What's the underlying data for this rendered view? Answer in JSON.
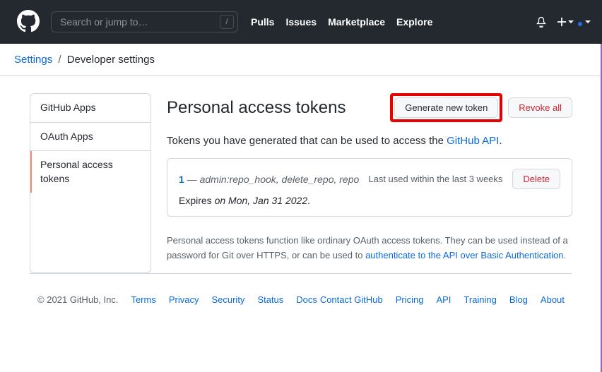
{
  "header": {
    "search_placeholder": "Search or jump to…",
    "slash": "/",
    "nav": {
      "pulls": "Pulls",
      "issues": "Issues",
      "marketplace": "Marketplace",
      "explore": "Explore"
    }
  },
  "breadcrumb": {
    "settings": "Settings",
    "sep": "/",
    "current": "Developer settings"
  },
  "sidebar": {
    "github_apps": "GitHub Apps",
    "oauth_apps": "OAuth Apps",
    "pat": "Personal access tokens"
  },
  "page": {
    "title": "Personal access tokens",
    "generate_btn": "Generate new token",
    "revoke_btn": "Revoke all",
    "sub_pre": "Tokens you have generated that can be used to access the ",
    "sub_link": "GitHub API",
    "sub_post": ".",
    "token": {
      "name": "1",
      "dash": " — ",
      "scopes": "admin:repo_hook, delete_repo, repo",
      "last_used": "Last used within the last 3 weeks",
      "delete": "Delete",
      "expires_pre": "Expires ",
      "expires_date": "on Mon, Jan 31 2022",
      "expires_post": "."
    },
    "desc_pre": "Personal access tokens function like ordinary OAuth access tokens. They can be used instead of a password for Git over HTTPS, or can be used to ",
    "desc_link": "authenticate to the API over Basic Authentication",
    "desc_post": "."
  },
  "footer": {
    "copyright": "© 2021 GitHub, Inc.",
    "row1": {
      "terms": "Terms",
      "privacy": "Privacy",
      "security": "Security",
      "status": "Status",
      "docs": "Docs"
    },
    "row2": {
      "contact": "Contact GitHub",
      "pricing": "Pricing",
      "api": "API",
      "training": "Training",
      "blog": "Blog",
      "about": "About"
    }
  }
}
